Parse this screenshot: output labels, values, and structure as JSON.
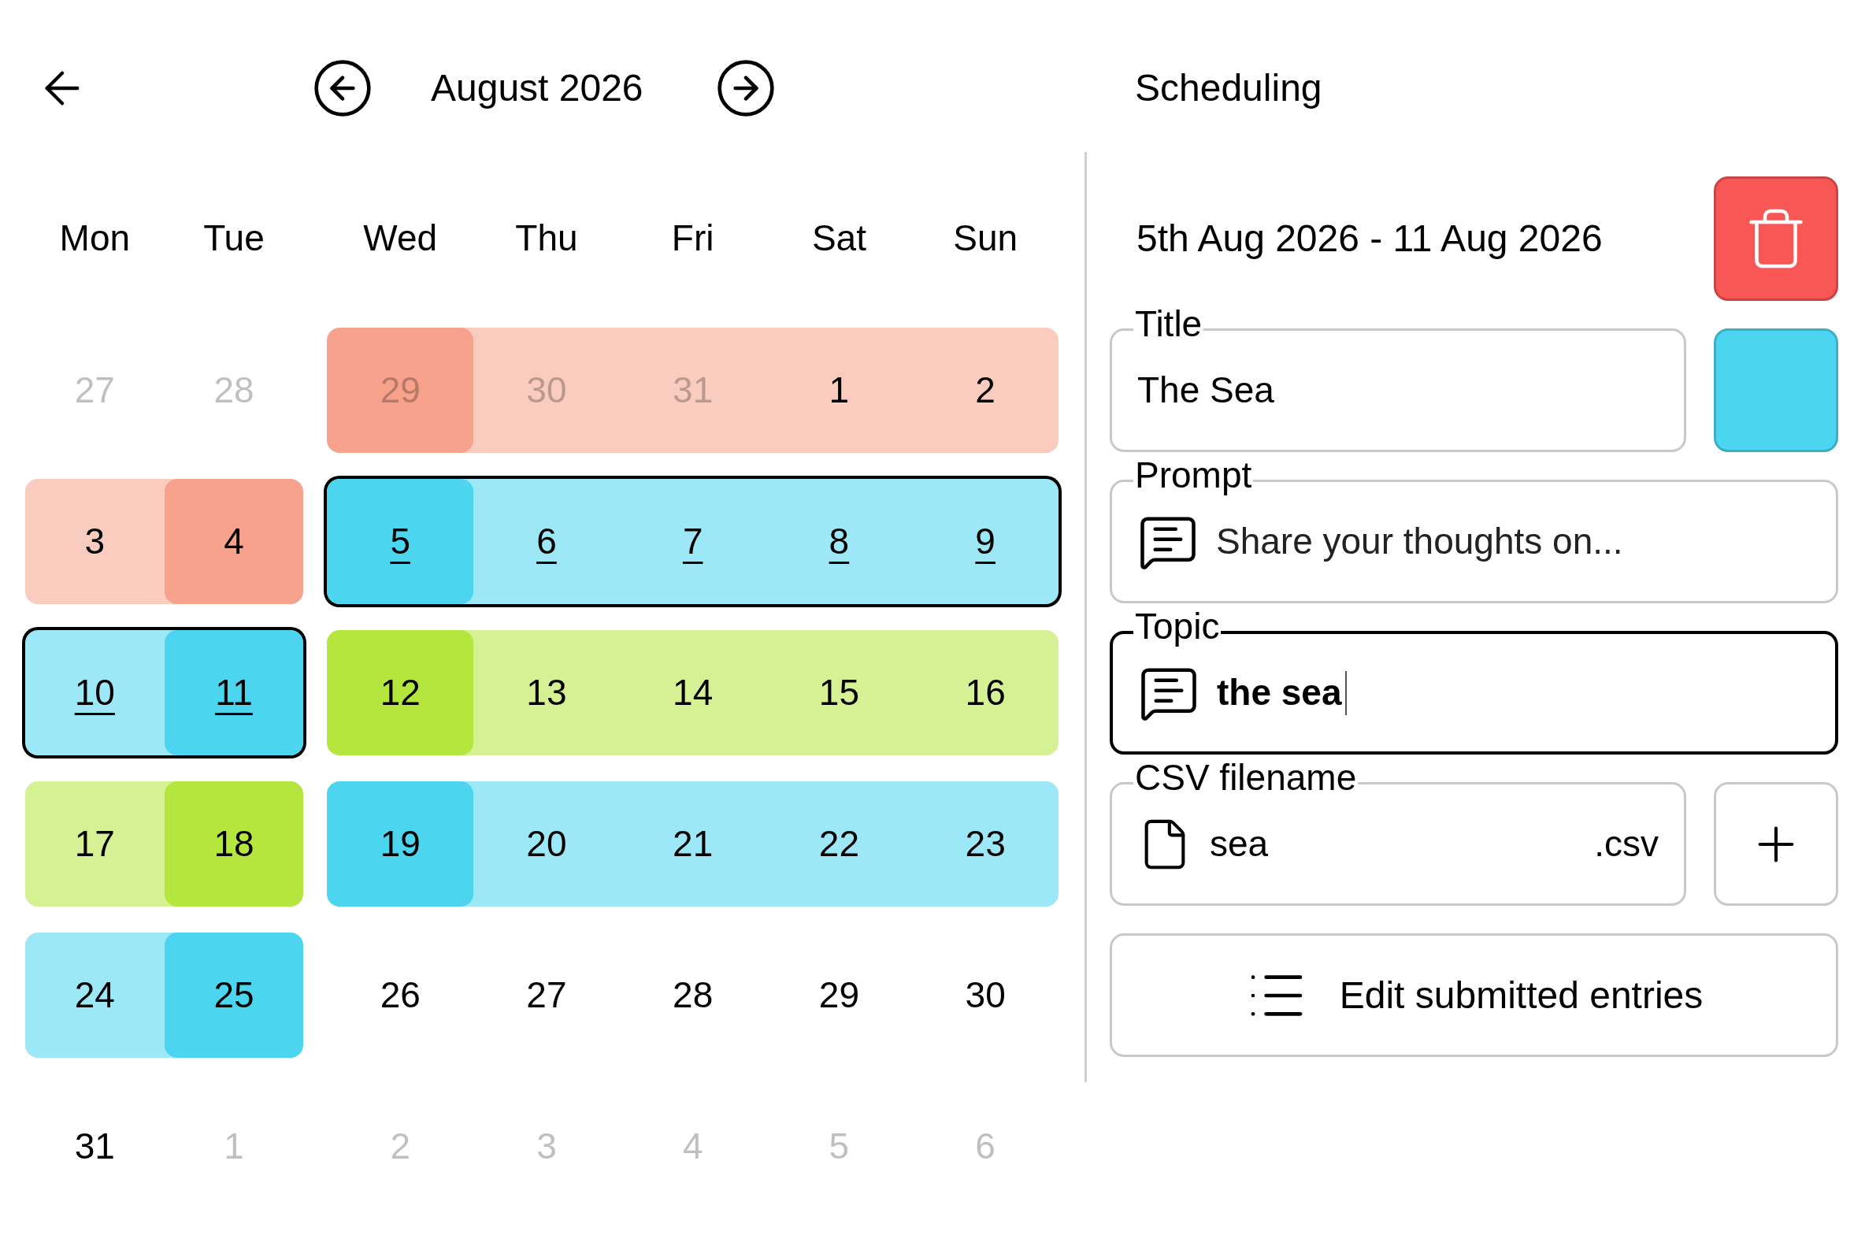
{
  "calendar": {
    "month": "August 2026",
    "weekdays": [
      "Mon",
      "Tue",
      "Wed",
      "Thu",
      "Fri",
      "Sat",
      "Sun"
    ],
    "weeks": [
      {
        "segments": [
          {
            "days": [
              {
                "label": "27",
                "muted": true
              },
              {
                "label": "28",
                "muted": true
              }
            ]
          },
          {
            "color": "#f6a28c",
            "selected": false,
            "days": [
              {
                "label": "29",
                "muted": true,
                "edge": true
              },
              {
                "label": "30",
                "muted": true,
                "edge": false
              },
              {
                "label": "31",
                "muted": true,
                "edge": false
              },
              {
                "label": "1",
                "muted": false,
                "edge": false
              },
              {
                "label": "2",
                "muted": false,
                "edge": false
              }
            ]
          }
        ]
      },
      {
        "segments": [
          {
            "color": "#f6a28c",
            "selected": false,
            "days": [
              {
                "label": "3",
                "muted": false,
                "edge": false
              },
              {
                "label": "4",
                "muted": false,
                "edge": true
              }
            ]
          },
          {
            "color": "#4bd5ef",
            "selected": true,
            "days": [
              {
                "label": "5",
                "muted": false,
                "edge": true
              },
              {
                "label": "6",
                "muted": false,
                "edge": false
              },
              {
                "label": "7",
                "muted": false,
                "edge": false
              },
              {
                "label": "8",
                "muted": false,
                "edge": false
              },
              {
                "label": "9",
                "muted": false,
                "edge": false
              }
            ]
          }
        ]
      },
      {
        "segments": [
          {
            "color": "#4bd5ef",
            "selected": true,
            "days": [
              {
                "label": "10",
                "muted": false,
                "edge": false
              },
              {
                "label": "11",
                "muted": false,
                "edge": true
              }
            ]
          },
          {
            "color": "#b5e63d",
            "selected": false,
            "days": [
              {
                "label": "12",
                "muted": false,
                "edge": true
              },
              {
                "label": "13",
                "muted": false,
                "edge": false
              },
              {
                "label": "14",
                "muted": false,
                "edge": false
              },
              {
                "label": "15",
                "muted": false,
                "edge": false
              },
              {
                "label": "16",
                "muted": false,
                "edge": false
              }
            ]
          }
        ]
      },
      {
        "segments": [
          {
            "color": "#b5e63d",
            "selected": false,
            "days": [
              {
                "label": "17",
                "muted": false,
                "edge": false
              },
              {
                "label": "18",
                "muted": false,
                "edge": true
              }
            ]
          },
          {
            "color": "#4bd5ef",
            "selected": false,
            "days": [
              {
                "label": "19",
                "muted": false,
                "edge": true
              },
              {
                "label": "20",
                "muted": false,
                "edge": false
              },
              {
                "label": "21",
                "muted": false,
                "edge": false
              },
              {
                "label": "22",
                "muted": false,
                "edge": false
              },
              {
                "label": "23",
                "muted": false,
                "edge": false
              }
            ]
          }
        ]
      },
      {
        "segments": [
          {
            "color": "#4bd5ef",
            "selected": false,
            "days": [
              {
                "label": "24",
                "muted": false,
                "edge": false
              },
              {
                "label": "25",
                "muted": false,
                "edge": true
              }
            ]
          },
          {
            "days": [
              {
                "label": "26",
                "muted": false
              },
              {
                "label": "27",
                "muted": false
              },
              {
                "label": "28",
                "muted": false
              },
              {
                "label": "29",
                "muted": false
              },
              {
                "label": "30",
                "muted": false
              }
            ]
          }
        ]
      },
      {
        "segments": [
          {
            "days": [
              {
                "label": "31",
                "muted": false
              },
              {
                "label": "1",
                "muted": true
              }
            ]
          },
          {
            "days": [
              {
                "label": "2",
                "muted": true
              },
              {
                "label": "3",
                "muted": true
              },
              {
                "label": "4",
                "muted": true
              },
              {
                "label": "5",
                "muted": true
              },
              {
                "label": "6",
                "muted": true
              }
            ]
          }
        ]
      }
    ]
  },
  "panel": {
    "title": "Scheduling",
    "range": "5th Aug 2026 - 11 Aug 2026",
    "title_field": {
      "label": "Title",
      "value": "The Sea",
      "color": "#4bd5ef",
      "focused": false
    },
    "prompt_field": {
      "label": "Prompt",
      "placeholder": "Share your thoughts on...",
      "focused": false
    },
    "topic_field": {
      "label": "Topic",
      "value": "the sea",
      "focused": true
    },
    "csv_field": {
      "label": "CSV filename",
      "value": "sea",
      "suffix": ".csv",
      "focused": false
    },
    "edit_button": "Edit submitted entries"
  }
}
